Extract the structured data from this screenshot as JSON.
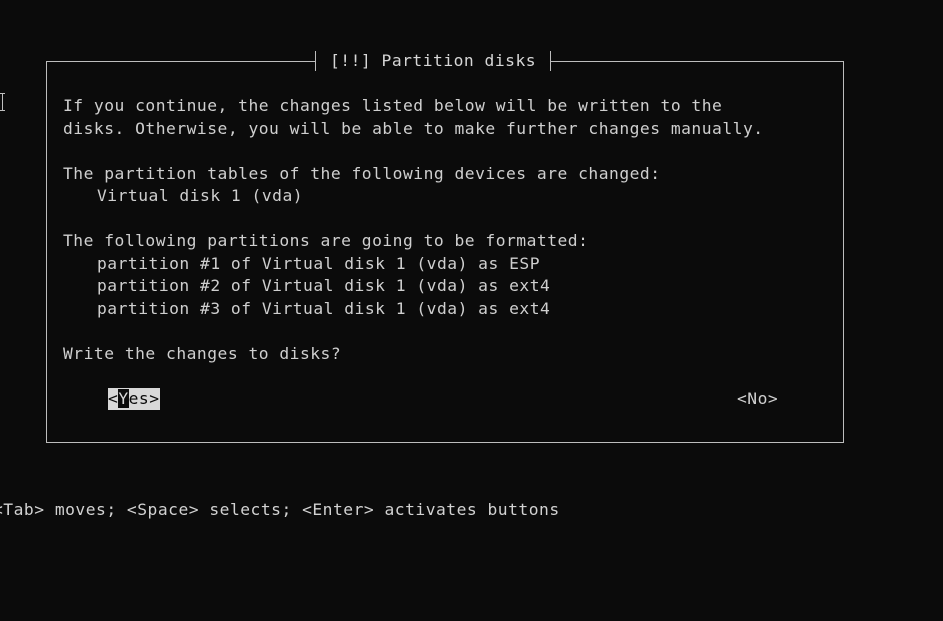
{
  "dialog": {
    "title": "[!!] Partition disks",
    "intro_line1": "If you continue, the changes listed below will be written to the",
    "intro_line2": "disks. Otherwise, you will be able to make further changes manually.",
    "tables_heading": "The partition tables of the following devices are changed:",
    "devices": [
      "Virtual disk 1 (vda)"
    ],
    "formatted_heading": "The following partitions are going to be formatted:",
    "partitions": [
      "partition #1 of Virtual disk 1 (vda) as ESP",
      "partition #2 of Virtual disk 1 (vda) as ext4",
      "partition #3 of Virtual disk 1 (vda) as ext4"
    ],
    "question": "Write the changes to disks?",
    "buttons": {
      "yes_prefix": "<",
      "yes_cursor": "Y",
      "yes_suffix": "es>",
      "no": "<No>"
    }
  },
  "footer": {
    "hint": "<Tab> moves; <Space> selects; <Enter> activates buttons"
  },
  "colors": {
    "background": "#0b0b0b",
    "text": "#cfcfcf",
    "border": "#bdbdbd",
    "selected_bg": "#d8d8d8"
  },
  "selected_button": "Yes",
  "icons": {
    "mouse_pointer": "text-cursor-ibeam-icon"
  }
}
